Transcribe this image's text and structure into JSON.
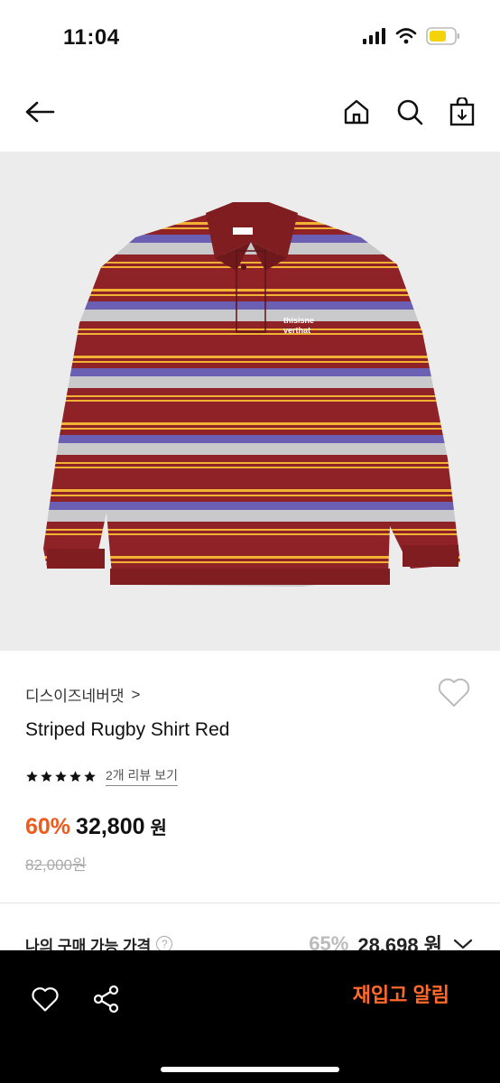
{
  "status_bar": {
    "time": "11:04",
    "icons": [
      "signal-icon",
      "wifi-icon",
      "battery-icon"
    ],
    "battery_color": "#f5d30a"
  },
  "nav": {
    "icons": [
      "back-arrow-icon",
      "home-icon",
      "search-icon",
      "shopping-bag-icon"
    ]
  },
  "product": {
    "brand": "디스이즈네버댓",
    "brand_chevron": ">",
    "name": "Striped Rugby Shirt Red",
    "rating": 5,
    "review_link": "2개 리뷰 보기",
    "discount": "60%",
    "sale_price": "32,800",
    "currency": "원",
    "original_price": "82,000원",
    "image_logo_text": [
      "thisisne",
      "verthat"
    ],
    "colors": {
      "accent": "#f05a1c",
      "shirt_base": "#8e2226",
      "stripe_gray": "#c9c9cc",
      "stripe_purple": "#6a5fb3",
      "stripe_yellow": "#f2b233"
    }
  },
  "my_price": {
    "label": "나의 구매 가능 가격",
    "help_icon": "?",
    "discount": "65%",
    "price": "28,698",
    "currency": "원"
  },
  "bottom_bar": {
    "icons": [
      "heart-icon",
      "share-icon"
    ],
    "restock_label": "재입고 알림"
  }
}
